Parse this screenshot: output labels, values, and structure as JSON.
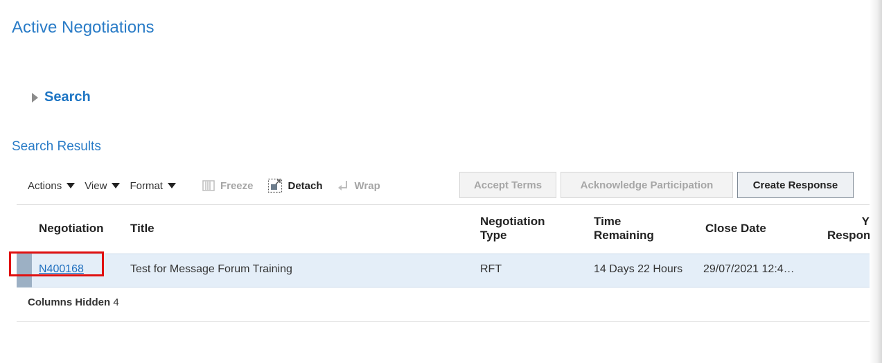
{
  "page": {
    "title": "Active Negotiations"
  },
  "search": {
    "label": "Search"
  },
  "results": {
    "title": "Search Results"
  },
  "toolbar": {
    "actions_label": "Actions",
    "view_label": "View",
    "format_label": "Format",
    "freeze_label": "Freeze",
    "detach_label": "Detach",
    "wrap_label": "Wrap"
  },
  "buttons": {
    "accept_terms": "Accept Terms",
    "acknowledge_participation": "Acknowledge Participation",
    "create_response": "Create Response"
  },
  "table": {
    "columns": {
      "negotiation": "Negotiation",
      "title": "Title",
      "negotiation_type_line1": "Negotiation",
      "negotiation_type_line2": "Type",
      "time_remaining_line1": "Time",
      "time_remaining_line2": "Remaining",
      "close_date": "Close Date",
      "your_response_line1": "Y",
      "your_response_line2": "Respon:"
    },
    "rows": [
      {
        "negotiation": "N400168",
        "title": "Test for Message Forum Training",
        "type": "RFT",
        "time_remaining": "14 Days 22 Hours",
        "close_date": "29/07/2021 12:4…"
      }
    ],
    "columns_hidden_label": "Columns Hidden",
    "columns_hidden_count": "4"
  },
  "colors": {
    "title_blue": "#2a7cc7",
    "link_blue": "#1f6fbf",
    "row_selected": "#e4eef8",
    "highlight_red": "#e01010"
  }
}
